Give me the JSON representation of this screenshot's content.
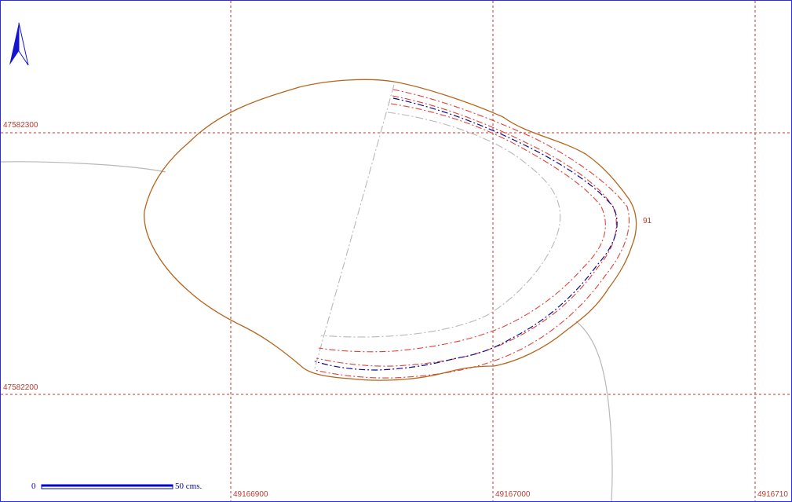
{
  "grid": {
    "x_labels": [
      "49166900",
      "49167000",
      "4916710"
    ],
    "y_labels": [
      "47582300",
      "47582200"
    ],
    "line_color": "#d0302a"
  },
  "contour": {
    "label": "91",
    "outline_color": "#b5651d",
    "offset_color": "#e0413a",
    "center_line_color": "#0a0a8a",
    "path_color": "#b8b8b8"
  },
  "north_arrow": {
    "icon": "north-arrow-icon",
    "color": "#1515d0"
  },
  "scale_bar": {
    "start_label": "0",
    "end_label": "50 cms.",
    "color": "#0000c8"
  }
}
